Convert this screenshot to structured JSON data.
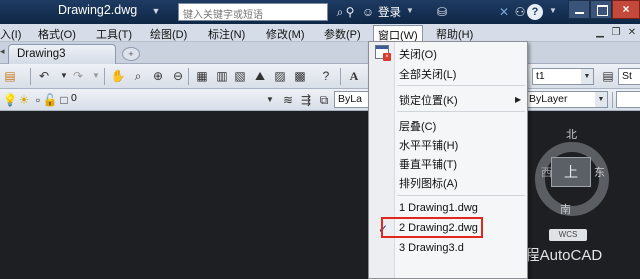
{
  "titlebar": {
    "document": "Drawing2.dwg",
    "search_placeholder": "键入关键字或短语",
    "login_label": "登录",
    "close_glyph": "×"
  },
  "menubar": {
    "items": [
      "入(I)",
      "格式(O)",
      "工具(T)",
      "绘图(D)",
      "标注(N)",
      "修改(M)",
      "参数(P)",
      "窗口(W)",
      "帮助(H)"
    ]
  },
  "tabs": [
    "Drawing3"
  ],
  "toolbars": {
    "layer_value": "0",
    "color_value": "ByLa",
    "lineweight_value": "ByLayer",
    "style_value": "St",
    "style_combo_value": "t1"
  },
  "window_menu": {
    "items": [
      {
        "label": "关闭(O)",
        "icon": "close-window-icon"
      },
      {
        "label": "全部关闭(L)"
      },
      {
        "label": "锁定位置(K)",
        "submenu": true
      },
      {
        "label": "层叠(C)"
      },
      {
        "label": "水平平铺(H)"
      },
      {
        "label": "垂直平铺(T)"
      },
      {
        "label": "排列图标(A)"
      },
      {
        "label": "1 Drawing1.dwg"
      },
      {
        "label": "2 Drawing2.dwg",
        "checked": true,
        "highlighted": true
      },
      {
        "label": "3 Drawing3.d"
      }
    ],
    "check_glyph": "✓",
    "submenu_arrow": "▶"
  },
  "viewcube": {
    "north": "北",
    "east": "东",
    "south": "南",
    "west": "西",
    "face": "上",
    "wcs": "WCS"
  },
  "watermark": "CAD教程AutoCAD",
  "colors": {
    "titlebar": "#1e3b63",
    "canvas": "#1d1f22",
    "highlight_border": "#e0281e",
    "close_button": "#c34a3a"
  }
}
